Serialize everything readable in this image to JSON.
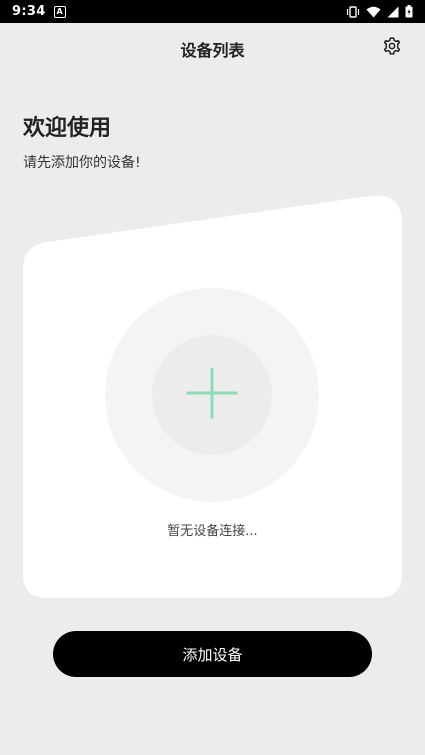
{
  "status_bar": {
    "time": "9:34",
    "notification_icon": "a-badge-icon",
    "icons": [
      "vibrate-icon",
      "wifi-icon",
      "signal-icon",
      "battery-icon"
    ]
  },
  "header": {
    "title": "设备列表",
    "settings_icon": "gear-icon"
  },
  "welcome": {
    "title": "欢迎使用",
    "subtitle": "请先添加你的设备!"
  },
  "device_card": {
    "add_icon": "plus-icon",
    "accent_color": "#8fdcb8",
    "empty_text": "暂无设备连接..."
  },
  "actions": {
    "add_device_label": "添加设备"
  }
}
